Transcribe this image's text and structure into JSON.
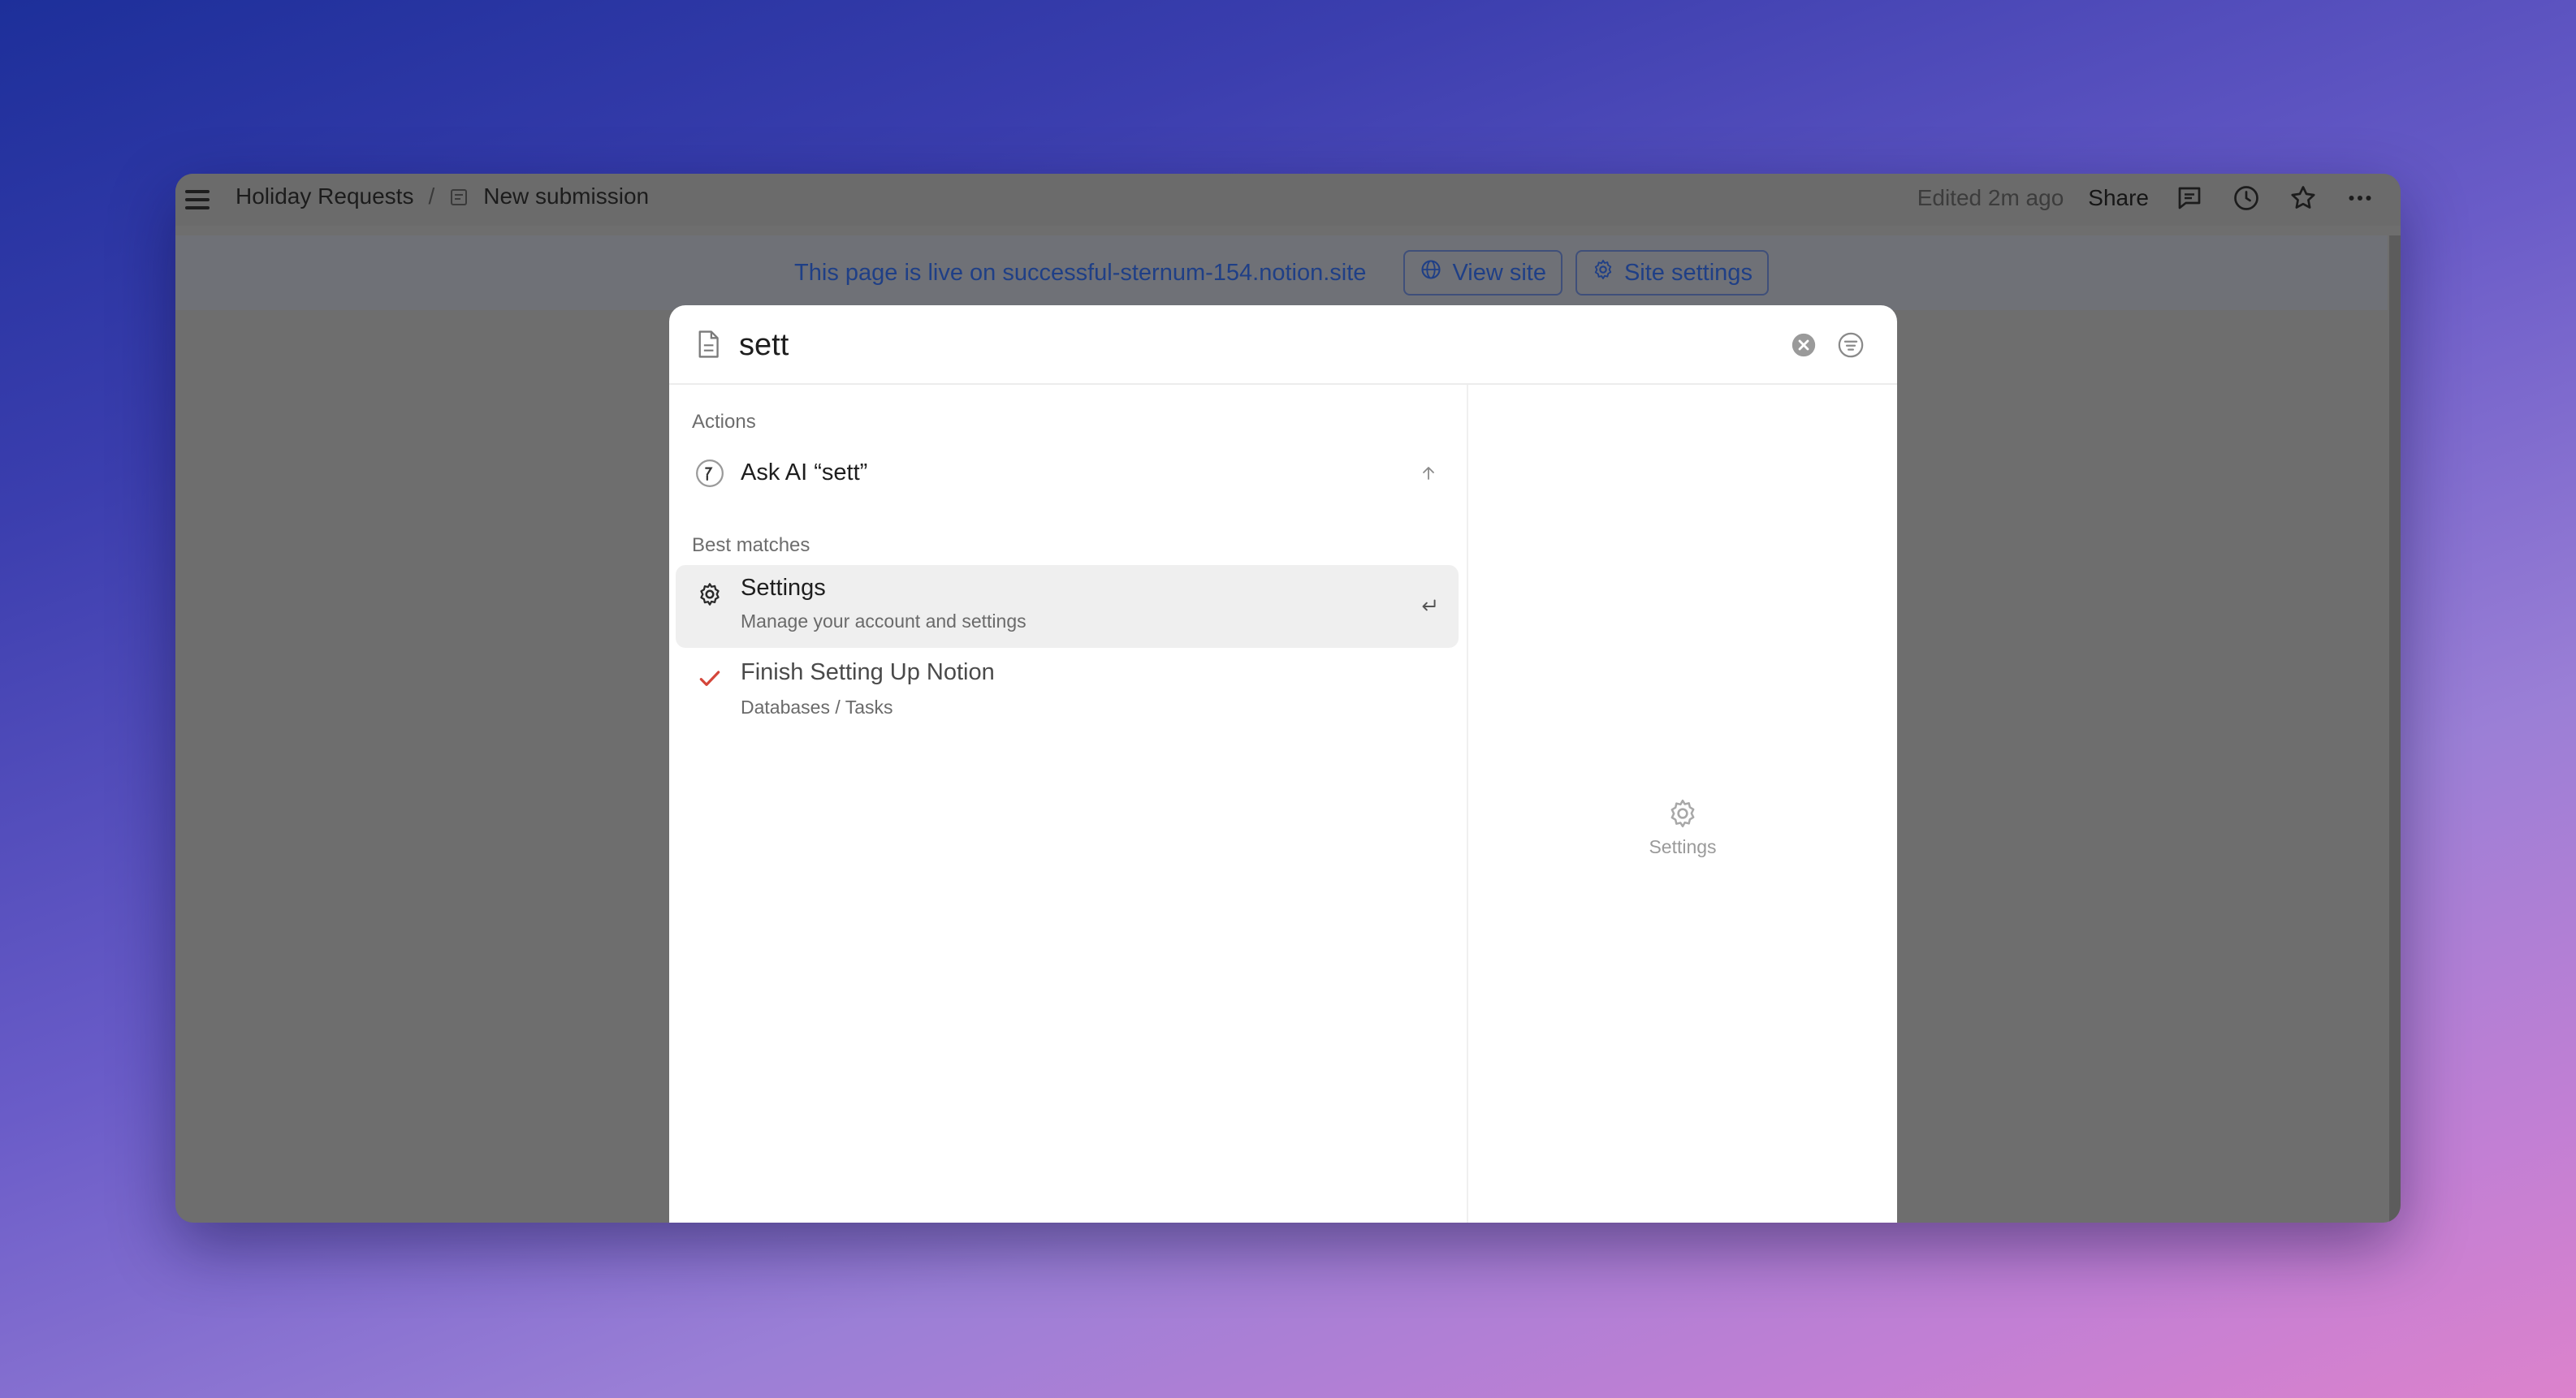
{
  "breadcrumb": {
    "parent": "Holiday Requests",
    "separator": "/",
    "current": "New submission"
  },
  "topbar": {
    "edited": "Edited 2m ago",
    "share": "Share",
    "icons": [
      "comments-icon",
      "history-icon",
      "star-icon",
      "more-icon"
    ]
  },
  "banner": {
    "text": "This page is live on successful-sternum-154.notion.site",
    "view_site": "View site",
    "site_settings": "Site settings"
  },
  "search": {
    "query": "sett"
  },
  "results": {
    "actions_label": "Actions",
    "ask_ai": "Ask AI “sett”",
    "best_matches_label": "Best matches",
    "items": [
      {
        "title": "Settings",
        "subtitle": "Manage your account and settings",
        "icon": "gear-icon"
      },
      {
        "title": "Finish Setting Up Notion",
        "subtitle": "Databases / Tasks",
        "icon": "checkmark-icon"
      }
    ]
  },
  "preview": {
    "label": "Settings",
    "icon": "gear-icon"
  },
  "colors": {
    "banner_text": "#1f3f86",
    "check": "#d4463a"
  }
}
